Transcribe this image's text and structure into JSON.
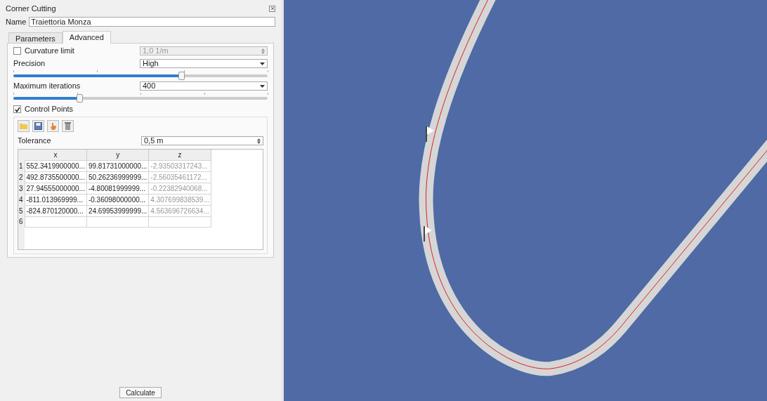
{
  "panel": {
    "title": "Corner Cutting",
    "name_label": "Name",
    "name_value": "Traiettoria Monza"
  },
  "tabs": [
    {
      "label": "Parameters",
      "selected": false
    },
    {
      "label": "Advanced",
      "selected": true
    }
  ],
  "curvature": {
    "label": "Curvature limit",
    "checked": false,
    "value": "1,0 1/m",
    "disabled": true
  },
  "precision": {
    "label": "Precision",
    "value": "High",
    "level": 0.66
  },
  "iterations": {
    "label": "Maximum iterations",
    "value": "400",
    "level": 0.26
  },
  "control_points": {
    "label": "Control Points",
    "checked": true,
    "tolerance_label": "Tolerance",
    "tolerance_value": "0,5 m",
    "columns": [
      {
        "label": "x",
        "disabled": false
      },
      {
        "label": "y",
        "disabled": false
      },
      {
        "label": "z",
        "disabled": true
      }
    ],
    "rows": [
      {
        "index": "1",
        "cells": [
          "552.3419900000...",
          "99.81731000000...",
          "-2.93503317243..."
        ]
      },
      {
        "index": "2",
        "cells": [
          "492.8735500000...",
          "50.26236999999...",
          "-2.56035461172..."
        ]
      },
      {
        "index": "3",
        "cells": [
          "27.94555000000...",
          "-4.80081999999...",
          "-0.22382940068..."
        ]
      },
      {
        "index": "4",
        "cells": [
          "-811.013969999...",
          "-0.36098000000...",
          "4.307699838539..."
        ]
      },
      {
        "index": "5",
        "cells": [
          "-824.870120000...",
          "24.69953999999...",
          "4.563696726634..."
        ]
      },
      {
        "index": "6",
        "cells": [
          "",
          "",
          ""
        ]
      }
    ]
  },
  "calculate_button": "Calculate"
}
